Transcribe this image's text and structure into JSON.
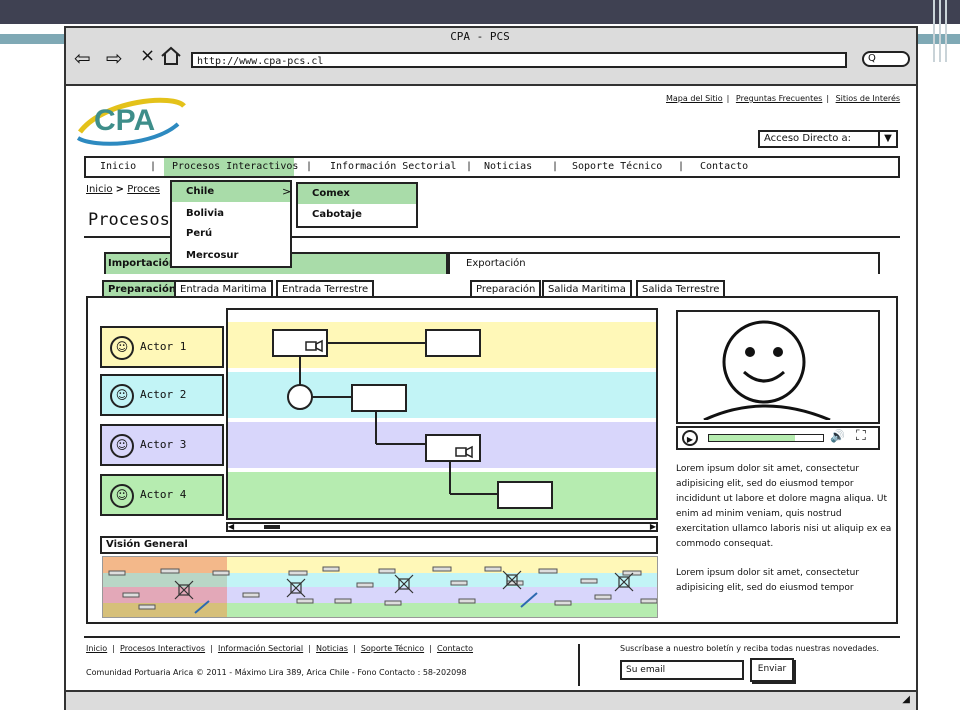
{
  "window": {
    "title": "CPA - PCS"
  },
  "browser": {
    "url": "http://www.cpa-pcs.cl",
    "search_glyph": "Q"
  },
  "colors": {
    "accent_green": "#a9dca9",
    "lane_yellow": "#fff8b8",
    "lane_cyan": "#c2f4f6",
    "lane_purple": "#d8d6fb",
    "lane_green": "#b6ecb0"
  },
  "header": {
    "logo_text": "CPA",
    "top_links": [
      "Mapa del Sitio",
      "Preguntas Frecuentes",
      "Sitios de Interés"
    ],
    "acceso_label": "Acceso Directo a:",
    "acceso_arrow": "▼"
  },
  "nav": {
    "items": [
      "Inicio",
      "Procesos Interactivos",
      "Información Sectorial",
      "Noticias",
      "Soporte Técnico",
      "Contacto"
    ],
    "separator": "|"
  },
  "breadcrumb": {
    "home": "Inicio",
    "separator": ">",
    "current": "Proces"
  },
  "page_title": "Procesos",
  "dropdown": {
    "level1": [
      "Chile",
      "Bolivia",
      "Perú",
      "Mercosur"
    ],
    "level1_arrow": ">",
    "level2": [
      "Comex",
      "Cabotaje"
    ]
  },
  "tabs": {
    "importacion": "Importación",
    "exportacion": "Exportación",
    "imp_sub": [
      "Preparación",
      "Entrada Maritima",
      "Entrada Terrestre"
    ],
    "exp_sub": [
      "Preparación",
      "Salida Maritima",
      "Salida Terrestre"
    ]
  },
  "actors": [
    "Actor 1",
    "Actor 2",
    "Actor 3",
    "Actor 4"
  ],
  "actor_face": "☺",
  "vision_general": "Visión General",
  "scroll": {
    "left": "◀",
    "right": "▶"
  },
  "video": {
    "play": "▶",
    "volume": "🔊",
    "fullscreen": "⛶",
    "progress": 0.75
  },
  "lorem1": "Lorem ipsum dolor sit amet, consectetur adipisicing elit, sed do eiusmod tempor incididunt ut labore et dolore magna aliqua. Ut enim ad minim veniam, quis nostrud exercitation ullamco laboris nisi ut aliquip ex ea commodo consequat.",
  "lorem2": "Lorem ipsum dolor sit amet, consectetur adipisicing elit, sed do eiusmod tempor",
  "footer": {
    "links": [
      "Inicio",
      "Procesos Interactivos",
      "Información Sectorial",
      "Noticias",
      "Soporte Técnico",
      "Contacto"
    ],
    "copyright": "Comunidad Portuaria Arica © 2011 - Máximo Lira 389, Arica Chile - Fono Contacto : 58-202098",
    "newsletter": "Suscríbase a nuestro boletín y reciba todas nuestras novedades.",
    "email_placeholder": "Su email",
    "send": "Enviar"
  }
}
